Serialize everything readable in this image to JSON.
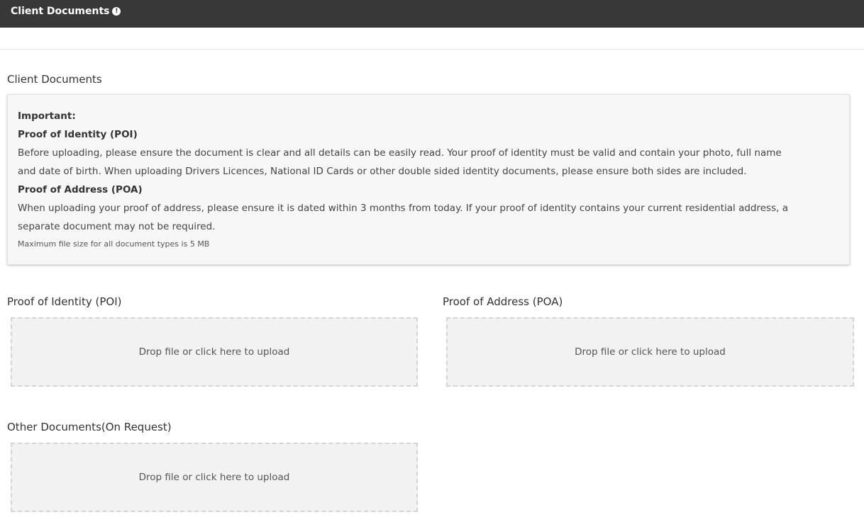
{
  "header": {
    "title": "Client Documents",
    "icon": "info-icon",
    "icon_glyph": "!"
  },
  "main": {
    "title": "Client Documents",
    "notice": {
      "heading": "Important:",
      "poi_heading": "Proof of Identity (POI)",
      "poi_line1": "Before uploading, please ensure the document is clear and all details can be easily read. Your proof of identity must be valid and contain your photo, full name",
      "poi_line2": "and date of birth. When uploading Drivers Licences, National ID Cards or other double sided identity documents, please ensure both sides are included.",
      "poa_heading": "Proof of Address (POA)",
      "poa_line1": "When uploading your proof of address, please ensure it is dated within 3 months from today. If your proof of identity contains your current residential address, a",
      "poa_line2": "separate document may not be required.",
      "file_size_note": "Maximum file size for all document types is 5 MB"
    },
    "uploads": {
      "poi": {
        "label": "Proof of Identity (POI)",
        "dropzone_text": "Drop file or click here to upload"
      },
      "poa": {
        "label": "Proof of Address (POA)",
        "dropzone_text": "Drop file or click here to upload"
      },
      "other": {
        "label": "Other Documents(On Request)",
        "dropzone_text": "Drop file or click here to upload"
      }
    }
  },
  "colors": {
    "header_bg": "#383838",
    "dropzone_bg": "#f2f2f2",
    "dropzone_border": "#d4d4d4",
    "notice_bg": "#f7f7f7"
  }
}
